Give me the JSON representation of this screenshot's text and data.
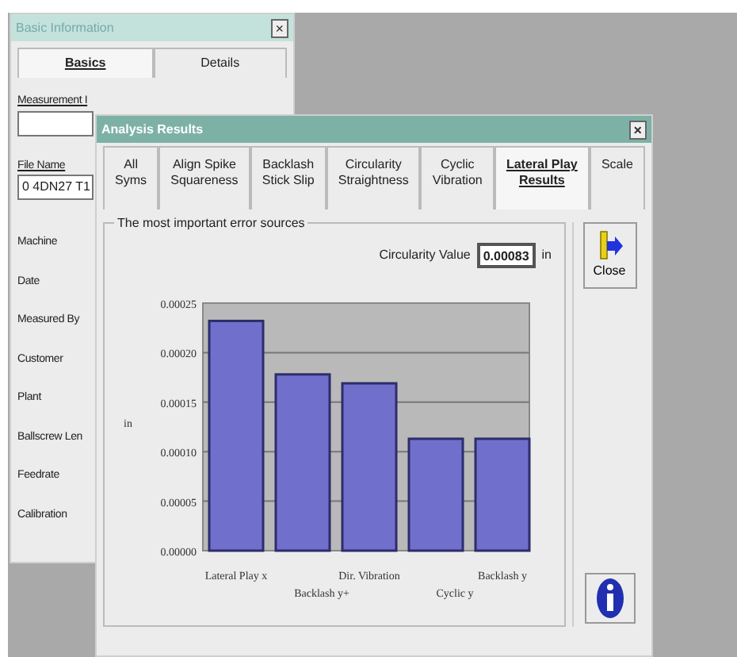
{
  "info_window": {
    "title": "Basic Information",
    "close": "×",
    "tabs": [
      {
        "label": "Basics",
        "selected": true
      },
      {
        "label": "Details",
        "selected": false
      }
    ],
    "fields": [
      {
        "label": "Measurement I"
      },
      {
        "label": "File Name",
        "value": "0 4DN27 T1"
      }
    ],
    "labels": [
      "Machine",
      "Date",
      "Measured By",
      "Customer",
      "Plant",
      "Ballscrew Len",
      "Feedrate",
      "Calibration"
    ]
  },
  "results_window": {
    "title": "Analysis Results",
    "close": "×",
    "tabs": [
      {
        "lines": [
          "All",
          "Syms"
        ],
        "selected": false
      },
      {
        "lines": [
          "Align Spike",
          "Squareness"
        ],
        "selected": false
      },
      {
        "lines": [
          "Backlash",
          "Stick Slip"
        ],
        "selected": false
      },
      {
        "lines": [
          "Circularity",
          "Straightness"
        ],
        "selected": false
      },
      {
        "lines": [
          "Cyclic",
          "Vibration"
        ],
        "selected": false
      },
      {
        "lines": [
          "Lateral Play",
          "Results"
        ],
        "selected": true
      },
      {
        "lines": [
          "Scale"
        ],
        "selected": false
      }
    ],
    "group_title": "The most important error sources",
    "circularity": {
      "label": "Circularity Value",
      "value": "0.00083",
      "unit": "in"
    },
    "close_button": "Close",
    "chart_data": {
      "type": "bar",
      "ylabel": "in",
      "categories": [
        "Lateral Play x",
        "Backlash y+",
        "Dir. Vibration",
        "Cyclic y",
        "Backlash y"
      ],
      "values": [
        0.000232,
        0.000178,
        0.000169,
        0.000113,
        0.000113
      ],
      "ylim": [
        0,
        0.00025
      ],
      "grid": true,
      "yticks": [
        {
          "value": 0,
          "label": "0.00000"
        },
        {
          "value": 5e-05,
          "label": "0.00005"
        },
        {
          "value": 0.0001,
          "label": "0.00010"
        },
        {
          "value": 0.00015,
          "label": "0.00015"
        },
        {
          "value": 0.0002,
          "label": "0.00020"
        },
        {
          "value": 0.00025,
          "label": "0.00025"
        }
      ]
    }
  }
}
